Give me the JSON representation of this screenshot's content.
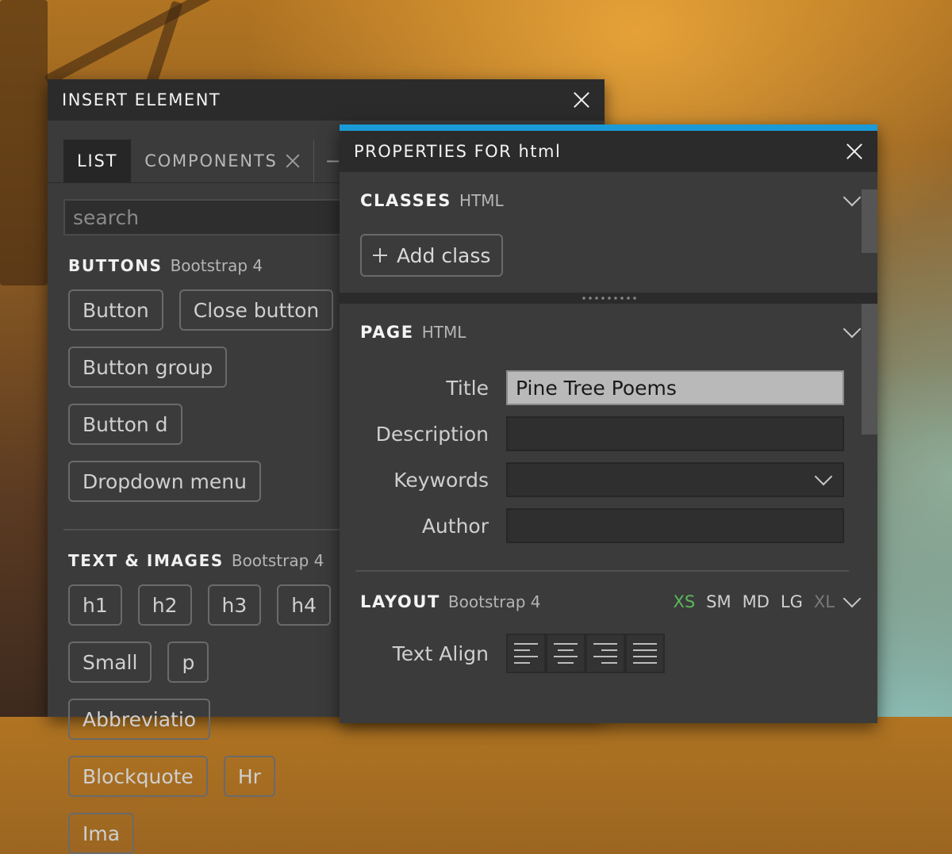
{
  "insert_panel": {
    "title": "INSERT ELEMENT",
    "tabs": [
      {
        "label": "LIST",
        "active": true
      },
      {
        "label": "COMPONENTS",
        "active": false
      }
    ],
    "tab_extra": "−",
    "search": {
      "placeholder": "search",
      "value": ""
    },
    "sections": [
      {
        "title": "BUTTONS",
        "subtitle": "Bootstrap 4",
        "items": [
          "Button",
          "Close button",
          "Button group",
          "Button d",
          "Dropdown menu"
        ]
      },
      {
        "title": "TEXT & IMAGES",
        "subtitle": "Bootstrap 4",
        "items": [
          "h1",
          "h2",
          "h3",
          "h4",
          "Small",
          "p",
          "Abbreviatio",
          "Blockquote",
          "Hr",
          "Ima"
        ]
      }
    ]
  },
  "props_panel": {
    "title": "PROPERTIES FOR html",
    "accent_color": "#1a9bd7",
    "classes": {
      "title": "CLASSES",
      "subtitle": "HTML",
      "add_label": "Add class"
    },
    "page": {
      "title": "PAGE",
      "subtitle": "HTML",
      "fields": [
        {
          "label": "Title",
          "value": "Pine Tree Poems"
        },
        {
          "label": "Description",
          "value": ""
        },
        {
          "label": "Keywords",
          "value": ""
        },
        {
          "label": "Author",
          "value": ""
        }
      ]
    },
    "layout": {
      "title": "LAYOUT",
      "subtitle": "Bootstrap 4",
      "sizes": [
        "XS",
        "SM",
        "MD",
        "LG",
        "XL"
      ],
      "active_size": "XS",
      "text_align_label": "Text Align",
      "align_options": [
        "left-icon",
        "center-icon",
        "right-icon",
        "justify-icon"
      ]
    }
  }
}
